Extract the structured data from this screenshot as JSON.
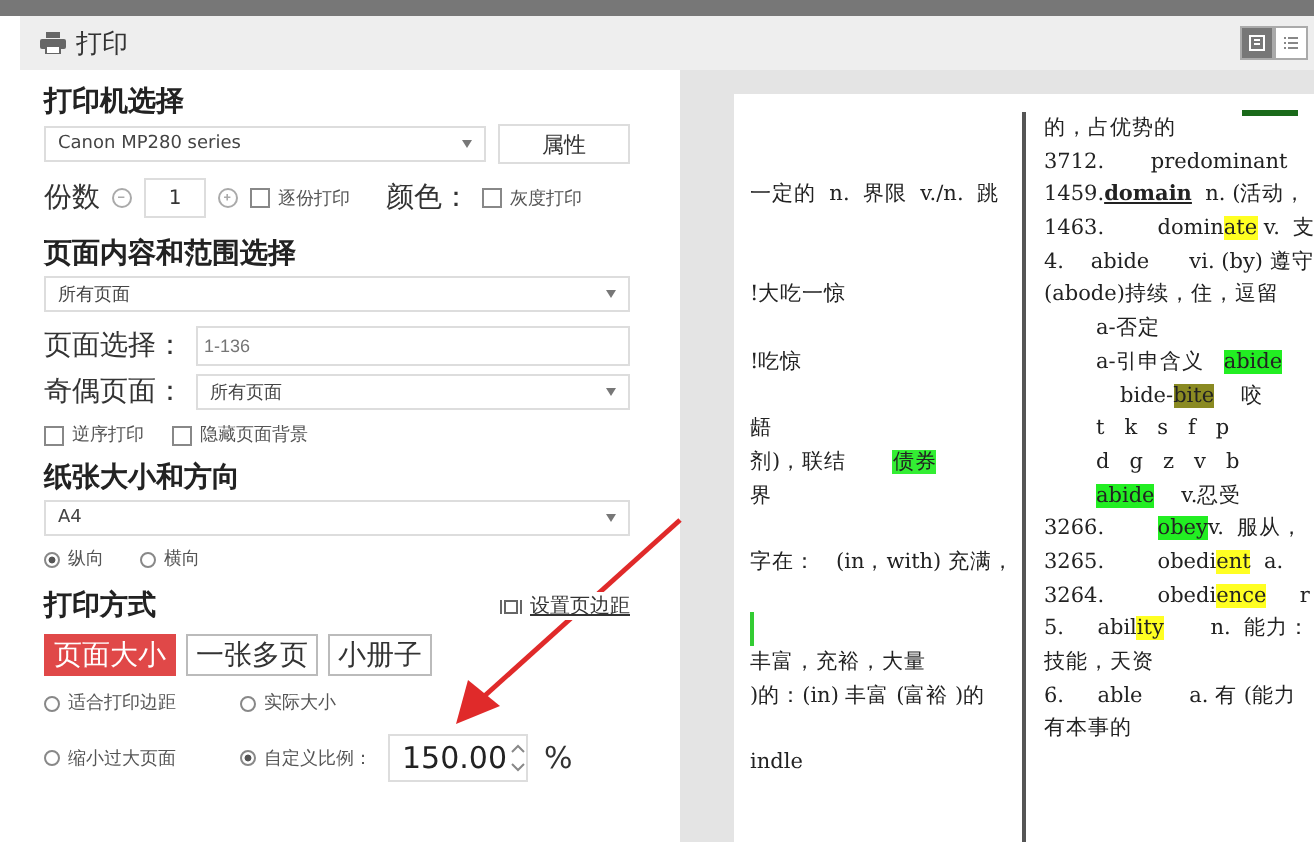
{
  "window": {
    "title": "打印"
  },
  "view_toggle": [
    {
      "selected": true
    },
    {
      "selected": false
    }
  ],
  "printer": {
    "heading": "打印机选择",
    "value": "Canon MP280 series",
    "button": "属性"
  },
  "copies": {
    "label": "份数",
    "value": "1",
    "collate": {
      "label": "逐份打印",
      "checked": false
    },
    "color_label": "颜色：",
    "grayscale": {
      "label": "灰度打印",
      "checked": false
    }
  },
  "range": {
    "heading": "页面内容和范围选择",
    "value": "所有页面",
    "pages_label": "页面选择：",
    "pages_field": {
      "placeholder": "1-136"
    },
    "odd_even_label": "奇偶页面：",
    "odd_even_value": "所有页面",
    "options": [
      {
        "label": "逆序打印",
        "checked": false
      },
      {
        "label": "隐藏页面背景",
        "checked": false
      }
    ]
  },
  "paper": {
    "heading": "纸张大小和方向",
    "value": "A4",
    "orientation": [
      {
        "label": "纵向",
        "selected": true
      },
      {
        "label": "横向",
        "selected": false
      }
    ]
  },
  "mode": {
    "heading": "打印方式",
    "margin_link": "设置页边距",
    "tabs": [
      {
        "label": "页面大小",
        "selected": true
      },
      {
        "label": "一张多页",
        "selected": false
      },
      {
        "label": "小册子",
        "selected": false
      }
    ],
    "scaling": [
      {
        "label": "适合打印边距",
        "selected": false
      },
      {
        "label": "实际大小",
        "selected": false
      },
      {
        "label": "缩小过大页面",
        "selected": false
      },
      {
        "label": "自定义比例：",
        "selected": true
      }
    ],
    "scale_value": "150.00",
    "unit": "%"
  },
  "preview": {
    "left_lines": [
      {
        "kind": "blank"
      },
      {
        "kind": "blank"
      },
      {
        "kind": "text",
        "segments": [
          {
            "text": "一定的  n.  界限  v./n.  跳"
          }
        ]
      },
      {
        "kind": "blank"
      },
      {
        "kind": "blank"
      },
      {
        "kind": "text",
        "segments": [
          {
            "text": "!大吃一惊"
          }
        ]
      },
      {
        "kind": "blank"
      },
      {
        "kind": "text",
        "segments": [
          {
            "text": "!吃惊"
          }
        ]
      },
      {
        "kind": "blank"
      },
      {
        "kind": "text",
        "segments": [
          {
            "text": "龉"
          }
        ]
      },
      {
        "kind": "text",
        "segments": [
          {
            "text": "剂)，联结       "
          },
          {
            "text": "债券",
            "color": "#33ee33"
          }
        ]
      },
      {
        "kind": "text",
        "segments": [
          {
            "text": "界"
          }
        ]
      },
      {
        "kind": "blank"
      },
      {
        "kind": "text",
        "segments": [
          {
            "text": "字在：   (in，with) 充满，"
          }
        ]
      },
      {
        "kind": "blank"
      },
      {
        "kind": "mark",
        "color": "#33cc33"
      },
      {
        "kind": "text",
        "segments": [
          {
            "text": "丰富，充裕，大量"
          }
        ]
      },
      {
        "kind": "text",
        "segments": [
          {
            "text": ")的：(in) 丰富 (富裕 )的"
          }
        ]
      },
      {
        "kind": "blank"
      },
      {
        "kind": "text",
        "segments": [
          {
            "text": "indle"
          }
        ]
      }
    ],
    "right_lines": [
      {
        "kind": "text",
        "segments": [
          {
            "text": "的，占优势的"
          }
        ]
      },
      {
        "kind": "text",
        "segments": [
          {
            "text": "3712.       predominant"
          }
        ]
      },
      {
        "kind": "text",
        "segments": [
          {
            "text": "1459."
          },
          {
            "text": "domain",
            "kind": "term"
          },
          {
            "text": "  n. (活动，"
          }
        ]
      },
      {
        "kind": "text",
        "segments": [
          {
            "text": "1463.        domin"
          },
          {
            "text": "ate",
            "color": "#ffff22"
          },
          {
            "text": " v.  支"
          }
        ]
      },
      {
        "kind": "text",
        "segments": [
          {
            "text": "4.    abide      vi. (by) 遵守"
          }
        ]
      },
      {
        "kind": "text",
        "segments": [
          {
            "text": "(abode)持续，住，逗留"
          }
        ]
      },
      {
        "kind": "sub",
        "segments": [
          {
            "text": "a-否定"
          }
        ]
      },
      {
        "kind": "sub",
        "segments": [
          {
            "text": "a-引申含义   "
          },
          {
            "text": "abide",
            "color": "#22ee22"
          }
        ]
      },
      {
        "kind": "sub2",
        "segments": [
          {
            "text": "bide-"
          },
          {
            "text": "bite",
            "color": "#8a8a22"
          },
          {
            "text": "    咬"
          }
        ]
      },
      {
        "kind": "sub",
        "segments": [
          {
            "text": "t   k   s   f   p"
          }
        ]
      },
      {
        "kind": "sub",
        "segments": [
          {
            "text": "d   g   z   v   b"
          }
        ]
      },
      {
        "kind": "sub",
        "segments": [
          {
            "text": "abide",
            "color": "#22ee22"
          },
          {
            "text": "    v.忍受"
          }
        ]
      },
      {
        "kind": "text",
        "segments": [
          {
            "text": "3266.        "
          },
          {
            "text": "obey",
            "color": "#22ee22"
          },
          {
            "text": "v.  服从，"
          }
        ]
      },
      {
        "kind": "text",
        "segments": [
          {
            "text": "3265.        obedi"
          },
          {
            "text": "ent",
            "color": "#ffff22"
          },
          {
            "text": "  a."
          }
        ]
      },
      {
        "kind": "text",
        "segments": [
          {
            "text": "3264.        obedi"
          },
          {
            "text": "ence",
            "color": "#ffff22"
          },
          {
            "text": "     r"
          }
        ]
      },
      {
        "kind": "text",
        "segments": [
          {
            "text": "5.     abil"
          },
          {
            "text": "ity",
            "color": "#ffff22"
          },
          {
            "text": "       n.  能力："
          }
        ]
      },
      {
        "kind": "text",
        "segments": [
          {
            "text": "技能，天资"
          }
        ]
      },
      {
        "kind": "text",
        "segments": [
          {
            "text": "6.     able       a. 有 (能力"
          }
        ]
      },
      {
        "kind": "text",
        "segments": [
          {
            "text": "有本事的"
          }
        ]
      }
    ]
  }
}
